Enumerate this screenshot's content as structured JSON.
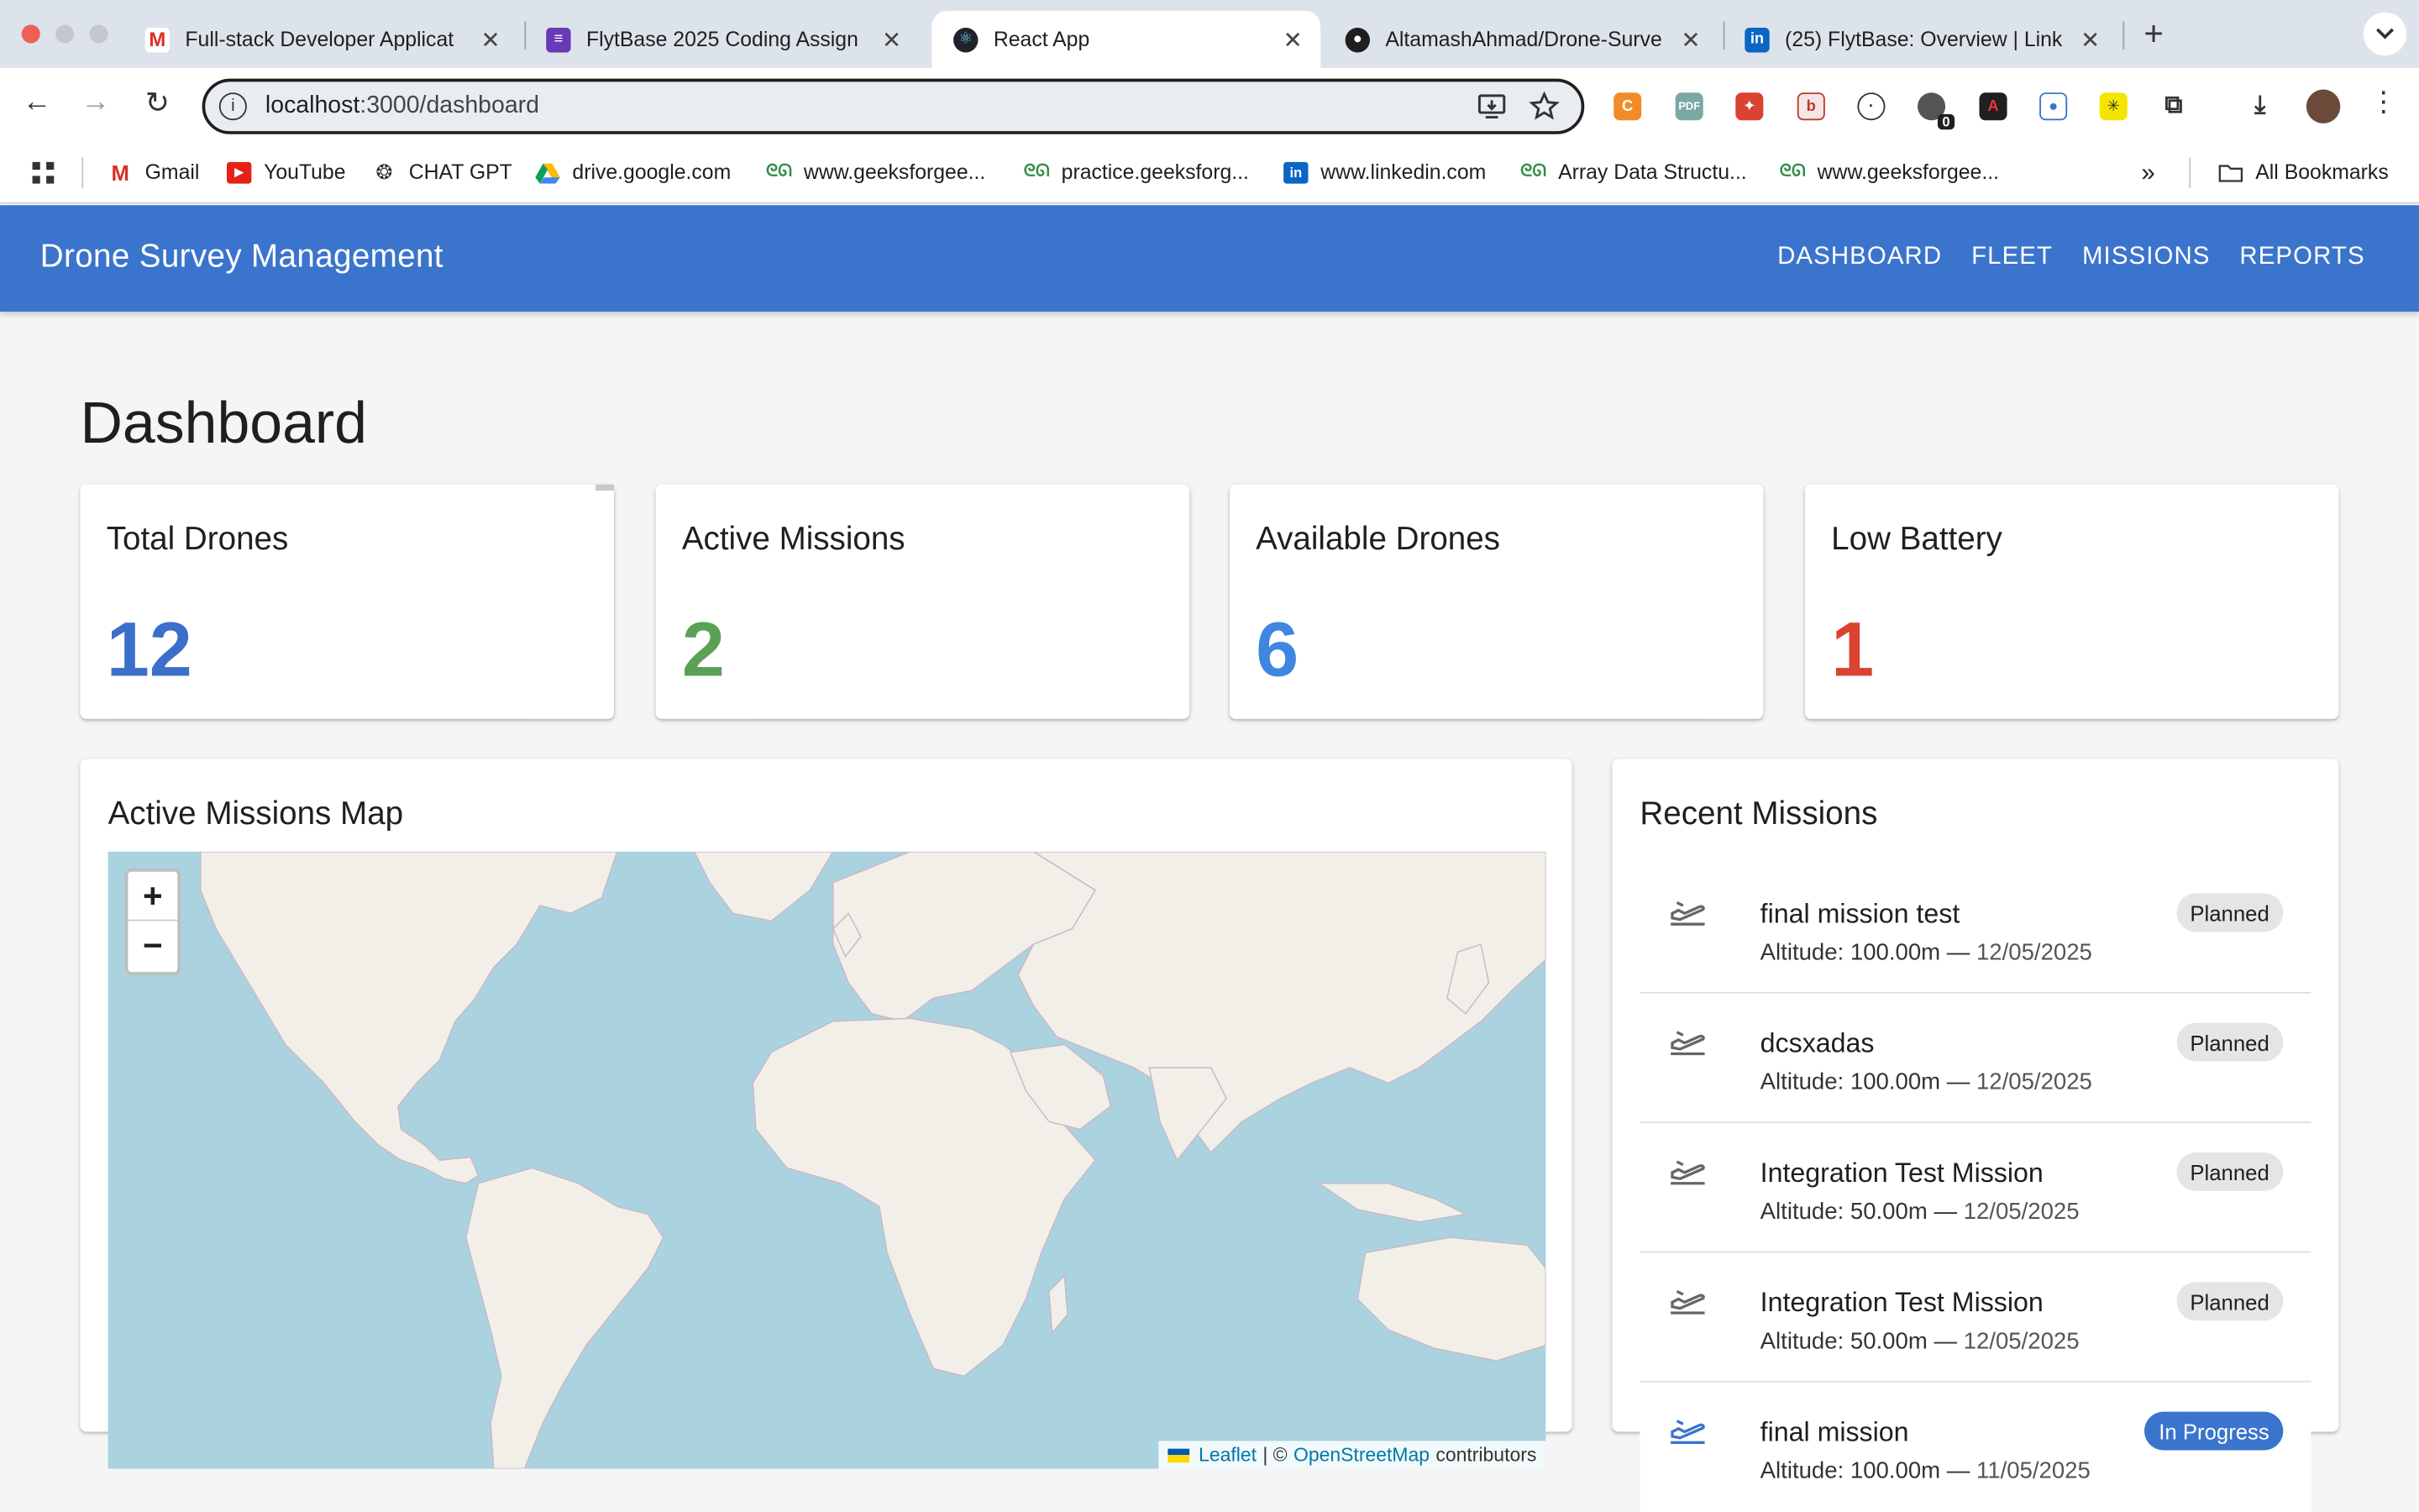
{
  "browser": {
    "tabs": [
      {
        "title": "Full-stack Developer Applicat",
        "active": false
      },
      {
        "title": "FlytBase 2025 Coding Assign",
        "active": false
      },
      {
        "title": "React App",
        "active": true
      },
      {
        "title": "AltamashAhmad/Drone-Surve",
        "active": false
      },
      {
        "title": "(25) FlytBase: Overview | Link",
        "active": false
      }
    ],
    "close_glyph": "✕",
    "new_tab": "+",
    "url_host": "localhost",
    "url_path": ":3000/dashboard",
    "extension_badge": "0",
    "bookmarks": [
      {
        "label": "Gmail",
        "icon": "gmail-icon"
      },
      {
        "label": "YouTube",
        "icon": "youtube-icon"
      },
      {
        "label": "CHAT GPT",
        "icon": "chatgpt-icon"
      },
      {
        "label": "drive.google.com",
        "icon": "drive-icon"
      },
      {
        "label": "www.geeksforgee...",
        "icon": "gfg-icon"
      },
      {
        "label": "practice.geeksforg...",
        "icon": "gfg-icon"
      },
      {
        "label": "www.linkedin.com",
        "icon": "linkedin-icon"
      },
      {
        "label": "Array Data Structu...",
        "icon": "gfg-icon"
      },
      {
        "label": "www.geeksforgee...",
        "icon": "gfg-icon"
      }
    ],
    "overflow": "»",
    "all_bookmarks": "All Bookmarks"
  },
  "app": {
    "brand": "Drone Survey Management",
    "nav": [
      "DASHBOARD",
      "FLEET",
      "MISSIONS",
      "REPORTS"
    ],
    "accent": "#3b74cc"
  },
  "dashboard": {
    "title": "Dashboard",
    "stats": [
      {
        "label": "Total Drones",
        "value": "12",
        "color": "#3b6fc9"
      },
      {
        "label": "Active Missions",
        "value": "2",
        "color": "#5aa155"
      },
      {
        "label": "Available Drones",
        "value": "6",
        "color": "#3f86de"
      },
      {
        "label": "Low Battery",
        "value": "1",
        "color": "#d9432f"
      }
    ],
    "map": {
      "title": "Active Missions Map",
      "zoom_in": "+",
      "zoom_out": "−",
      "attribution_leaflet": "Leaflet",
      "attribution_sep": "| ©",
      "attribution_osm": "OpenStreetMap",
      "attribution_suffix": "contributors"
    },
    "recent": {
      "title": "Recent Missions",
      "items": [
        {
          "name": "final mission test",
          "altitude": "Altitude: 100.00m",
          "sep": "—",
          "date": "12/05/2025",
          "status": "Planned"
        },
        {
          "name": "dcsxadas",
          "altitude": "Altitude: 100.00m",
          "sep": "—",
          "date": "12/05/2025",
          "status": "Planned"
        },
        {
          "name": "Integration Test Mission",
          "altitude": "Altitude: 50.00m",
          "sep": "—",
          "date": "12/05/2025",
          "status": "Planned"
        },
        {
          "name": "Integration Test Mission",
          "altitude": "Altitude: 50.00m",
          "sep": "—",
          "date": "12/05/2025",
          "status": "Planned"
        },
        {
          "name": "final mission",
          "altitude": "Altitude: 100.00m",
          "sep": "—",
          "date": "11/05/2025",
          "status": "In Progress"
        }
      ]
    }
  }
}
